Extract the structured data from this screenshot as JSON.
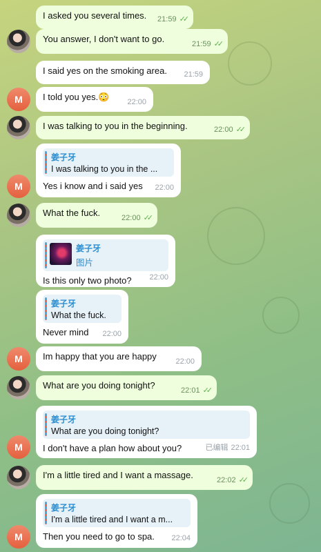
{
  "messages": [
    {
      "text": "I asked you several times.",
      "time": "21:59",
      "status": "✓✓"
    },
    {
      "text": "You answer, I don't want to go.",
      "time": "21:59",
      "status": "✓✓"
    },
    {
      "text": "I said yes on the smoking area.",
      "time": "21:59"
    },
    {
      "text": "I told you yes.😳",
      "time": "22:00"
    },
    {
      "text": "I was talking to you in the beginning.",
      "time": "22:00",
      "status": "✓✓"
    },
    {
      "quote_name": "姜子牙",
      "quote_text": "I was talking to you in the ...",
      "text": "Yes i know and i said yes",
      "time": "22:00"
    },
    {
      "text": "What the fuck.",
      "time": "22:00",
      "status": "✓✓"
    },
    {
      "quote_name": "姜子牙",
      "quote_text": "图片",
      "text": "Is this only two photo?",
      "time": "22:00"
    },
    {
      "quote_name": "姜子牙",
      "quote_text": "What the fuck.",
      "text": "Never mind",
      "time": "22:00"
    },
    {
      "text": "Im happy that you are happy",
      "time": "22:00"
    },
    {
      "text": "What are you doing tonight?",
      "time": "22:01",
      "status": "✓✓"
    },
    {
      "quote_name": "姜子牙",
      "quote_text": "What are you doing tonight?",
      "text": "I don't have a plan how about you?",
      "time": "22:01",
      "edited": "已编辑"
    },
    {
      "text": "I'm a little tired and I want a massage.",
      "time": "22:02",
      "status": "✓✓"
    },
    {
      "quote_name": "姜子牙",
      "quote_text": "I'm a little tired and I want a m...",
      "text": "Then you need to go to spa.",
      "time": "22:04"
    }
  ],
  "avatars": {
    "letter": "M"
  },
  "colors": {
    "outgoing_bubble": "#effedd",
    "incoming_bubble": "#ffffff",
    "check": "#5fb24c",
    "quote_name": "#2e8fd0",
    "letter_avatar": "#e4603e"
  }
}
